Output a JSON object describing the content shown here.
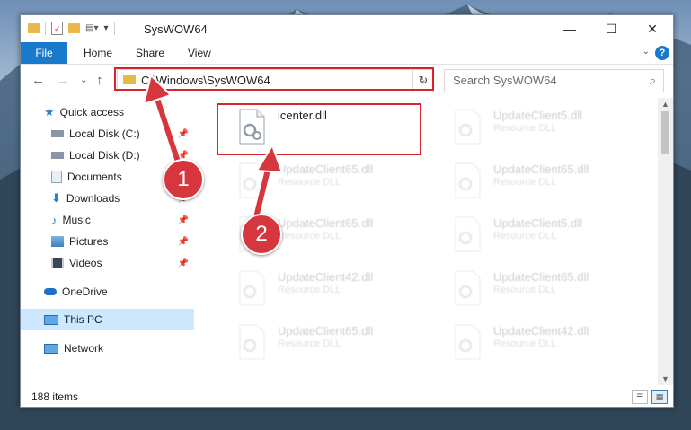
{
  "window": {
    "title": "SysWOW64",
    "controls": {
      "minimize": "—",
      "maximize": "☐",
      "close": "✕"
    }
  },
  "ribbon": {
    "file_tab": "File",
    "tabs": [
      "Home",
      "Share",
      "View"
    ],
    "help": "?"
  },
  "address_bar": {
    "path": "C:\\Windows\\SysWOW64",
    "search_placeholder": "Search SysWOW64"
  },
  "sidebar": {
    "items": [
      {
        "label": "Quick access",
        "icon": "star-icon",
        "pinned": false
      },
      {
        "label": "Local Disk (C:)",
        "icon": "drive-icon",
        "pinned": true
      },
      {
        "label": "Local Disk (D:)",
        "icon": "drive-icon",
        "pinned": true
      },
      {
        "label": "Documents",
        "icon": "documents-icon",
        "pinned": true
      },
      {
        "label": "Downloads",
        "icon": "download-icon",
        "pinned": true
      },
      {
        "label": "Music",
        "icon": "music-icon",
        "pinned": true
      },
      {
        "label": "Pictures",
        "icon": "pictures-icon",
        "pinned": true
      },
      {
        "label": "Videos",
        "icon": "videos-icon",
        "pinned": true
      },
      {
        "label": "OneDrive",
        "icon": "cloud-icon",
        "pinned": false
      },
      {
        "label": "This PC",
        "icon": "computer-icon",
        "pinned": false,
        "selected": true
      },
      {
        "label": "Network",
        "icon": "network-icon",
        "pinned": false
      }
    ]
  },
  "files": [
    {
      "name": "icenter.dll",
      "type": ""
    },
    {
      "name": "UpdateClient5.dll",
      "type": "Resource DLL"
    },
    {
      "name": "UpdateClient65.dll",
      "type": "Resource DLL"
    },
    {
      "name": "UpdateClient65.dll",
      "type": "Resource DLL"
    },
    {
      "name": "UpdateClient65.dll",
      "type": "Resource DLL"
    },
    {
      "name": "UpdateClient5.dll",
      "type": "Resource DLL"
    },
    {
      "name": "UpdateClient42.dll",
      "type": "Resource DLL"
    },
    {
      "name": "UpdateClient65.dll",
      "type": "Resource DLL"
    },
    {
      "name": "UpdateClient65.dll",
      "type": "Resource DLL"
    },
    {
      "name": "UpdateClient42.dll",
      "type": "Resource DLL"
    }
  ],
  "status": {
    "item_count": "188 items"
  },
  "annotations": {
    "step1": "1",
    "step2": "2",
    "color": "#d9242e"
  }
}
